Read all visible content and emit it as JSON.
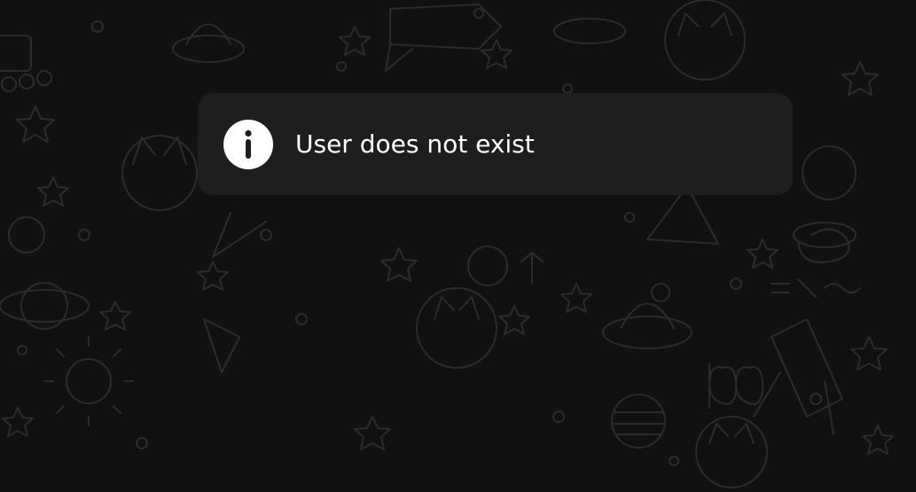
{
  "toast": {
    "icon": "info-icon",
    "message": "User does not exist"
  },
  "background": {
    "pattern": "space-doodle-wallpaper",
    "color": "#111111",
    "doodle_color": "#2b2b2b"
  },
  "colors": {
    "toast_background": "#1e1e1e",
    "toast_text": "#ffffff",
    "icon_fill": "#ffffff",
    "icon_glyph": "#1e1e1e"
  }
}
